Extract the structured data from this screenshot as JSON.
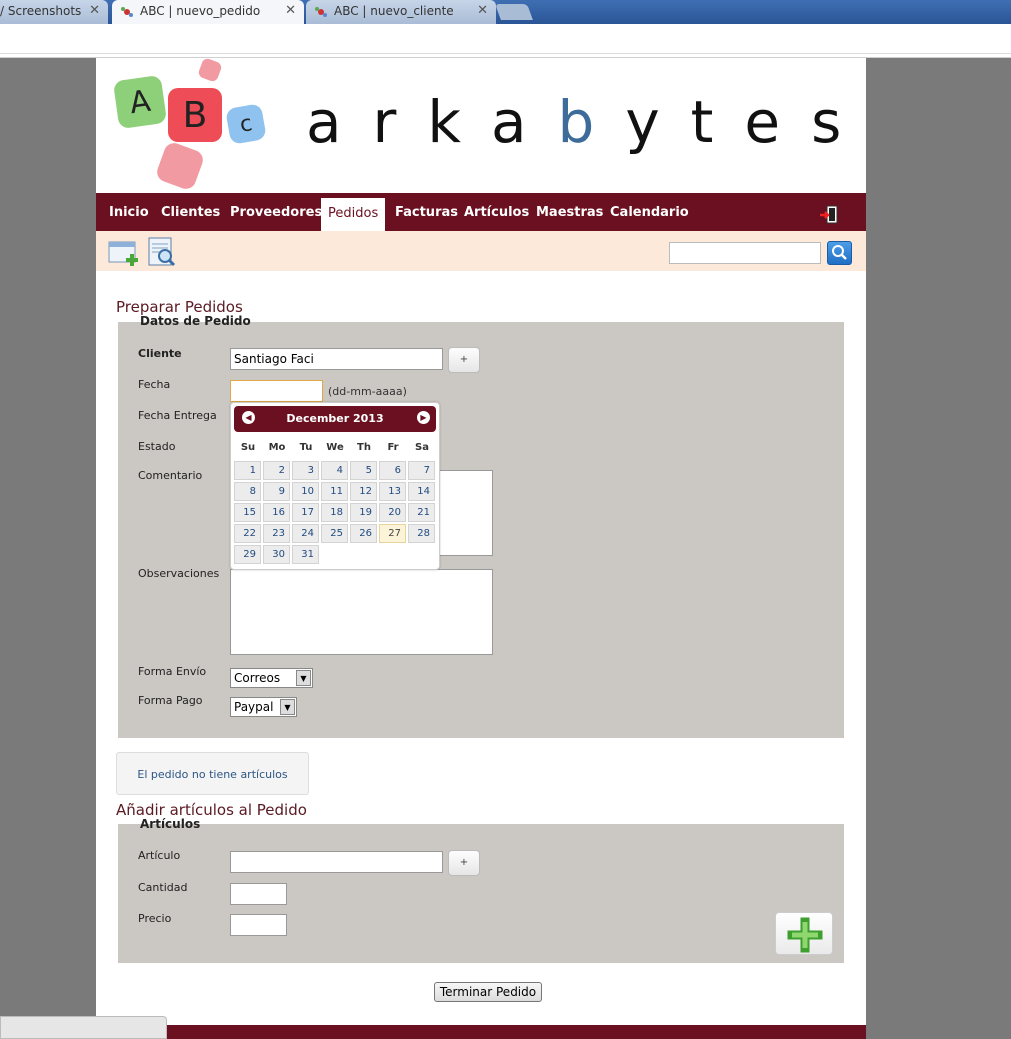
{
  "browser": {
    "tabs": [
      {
        "label": "/ Screenshots",
        "active": false
      },
      {
        "label": "ABC | nuevo_pedido",
        "active": true
      },
      {
        "label": "ABC | nuevo_cliente",
        "active": false
      }
    ]
  },
  "brand": {
    "letters_before": "arka",
    "highlight": "b",
    "letters_after": "ytes",
    "logo_letters": [
      "A",
      "B",
      "c"
    ]
  },
  "nav": {
    "items": [
      "Inicio",
      "Clientes",
      "Proveedores",
      "Pedidos",
      "Facturas",
      "Artículos",
      "Maestras",
      "Calendario"
    ],
    "active": "Pedidos",
    "logout_icon": "logout-icon"
  },
  "toolbar": {
    "icons": [
      "new-order-icon",
      "search-order-icon"
    ],
    "search_value": "",
    "search_icon": "magnifier-icon"
  },
  "order": {
    "title": "Preparar Pedidos",
    "legend": "Datos de Pedido",
    "labels": {
      "cliente": "Cliente",
      "fecha": "Fecha",
      "fecha_entrega": "Fecha Entrega",
      "estado": "Estado",
      "comentario": "Comentario",
      "observaciones": "Observaciones",
      "forma_envio": "Forma Envío",
      "forma_pago": "Forma Pago"
    },
    "cliente_value": "Santiago Faci",
    "add_button": "+",
    "fecha_value": "",
    "fecha_hint": "(dd-mm-aaaa)",
    "forma_envio_value": "Correos",
    "forma_pago_value": "Paypal"
  },
  "datepicker": {
    "month_label": "December 2013",
    "dow": [
      "Su",
      "Mo",
      "Tu",
      "We",
      "Th",
      "Fr",
      "Sa"
    ],
    "days": [
      "1",
      "2",
      "3",
      "4",
      "5",
      "6",
      "7",
      "8",
      "9",
      "10",
      "11",
      "12",
      "13",
      "14",
      "15",
      "16",
      "17",
      "18",
      "19",
      "20",
      "21",
      "22",
      "23",
      "24",
      "25",
      "26",
      "27",
      "28",
      "29",
      "30",
      "31"
    ],
    "highlighted_day": "27"
  },
  "info": {
    "message": "El pedido no tiene artículos"
  },
  "articles": {
    "title": "Añadir artículos al Pedido",
    "legend": "Artículos",
    "labels": {
      "articulo": "Artículo",
      "cantidad": "Cantidad",
      "precio": "Precio"
    },
    "add_button": "+",
    "articulo_value": "",
    "cantidad_value": "",
    "precio_value": ""
  },
  "finish_button": "Terminar Pedido",
  "colors": {
    "brand_maroon": "#6b1020",
    "panel": "#cbc7c2",
    "toolbar_bg": "#fde9d9"
  }
}
